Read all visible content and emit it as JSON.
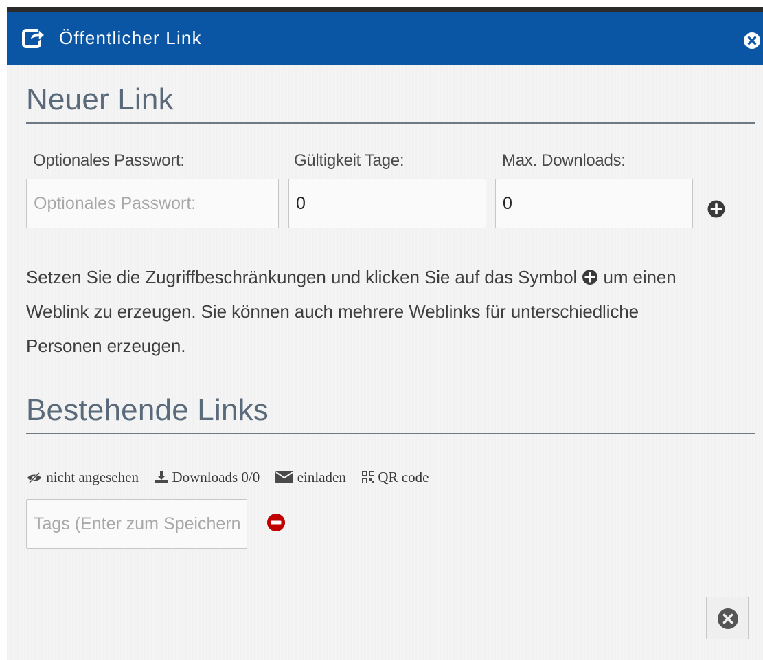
{
  "dialog": {
    "title": "Öffentlicher Link",
    "title_icon": "share-icon",
    "close_icon": "close-circle-icon"
  },
  "new_link": {
    "heading": "Neuer Link",
    "password_label": "Optionales Passwort:",
    "password_placeholder": "Optionales Passwort:",
    "password_value": "",
    "validity_label": "Gültigkeit Tage:",
    "validity_value": "0",
    "max_downloads_label": "Max. Downloads:",
    "max_downloads_value": "0",
    "add_icon": "plus-circle-icon",
    "help_before_icon": "Setzen Sie die Zugriffbeschränkungen und klicken Sie auf das Symbol",
    "help_after_icon": "um einen Weblink zu erzeugen. Sie können auch mehrere Weblinks für unterschiedliche Personen erzeugen."
  },
  "existing_links": {
    "heading": "Bestehende Links",
    "items": {
      "views": "nicht angesehen",
      "downloads": "Downloads 0/0",
      "invite": "einladen",
      "qr": "QR code"
    },
    "tags_placeholder": "Tags (Enter zum Speichern)",
    "remove_icon": "minus-circle-icon"
  },
  "footer": {
    "close_icon": "close-circle-icon"
  },
  "colors": {
    "title_bar": "#0b56a4",
    "remove": "#c00000",
    "heading": "#5a6a7a"
  }
}
